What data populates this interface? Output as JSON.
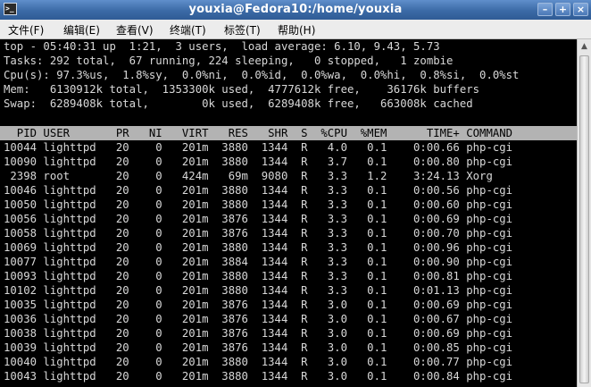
{
  "window": {
    "title": "youxia@Fedora10:/home/youxia",
    "icon_name": "terminal-icon",
    "minimize": "–",
    "maximize": "+",
    "close": "×"
  },
  "menu": [
    "文件(F)",
    "编辑(E)",
    "查看(V)",
    "终端(T)",
    "标签(T)",
    "帮助(H)"
  ],
  "summary": [
    "top - 05:40:31 up  1:21,  3 users,  load average: 6.10, 9.43, 5.73",
    "Tasks: 292 total,  67 running, 224 sleeping,   0 stopped,   1 zombie",
    "Cpu(s): 97.3%us,  1.8%sy,  0.0%ni,  0.0%id,  0.0%wa,  0.0%hi,  0.8%si,  0.0%st",
    "Mem:   6130912k total,  1353300k used,  4777612k free,    36176k buffers",
    "Swap:  6289408k total,        0k used,  6289408k free,   663008k cached"
  ],
  "columns": [
    "PID",
    "USER",
    "PR",
    "NI",
    "VIRT",
    "RES",
    "SHR",
    "S",
    "%CPU",
    "%MEM",
    "TIME+",
    "COMMAND"
  ],
  "processes": [
    [
      "10044",
      "lighttpd",
      "20",
      "0",
      "201m",
      "3880",
      "1344",
      "R",
      "4.0",
      "0.1",
      "0:00.66",
      "php-cgi"
    ],
    [
      "10090",
      "lighttpd",
      "20",
      "0",
      "201m",
      "3880",
      "1344",
      "R",
      "3.7",
      "0.1",
      "0:00.80",
      "php-cgi"
    ],
    [
      "2398",
      "root",
      "20",
      "0",
      "424m",
      "69m",
      "9080",
      "R",
      "3.3",
      "1.2",
      "3:24.13",
      "Xorg"
    ],
    [
      "10046",
      "lighttpd",
      "20",
      "0",
      "201m",
      "3880",
      "1344",
      "R",
      "3.3",
      "0.1",
      "0:00.56",
      "php-cgi"
    ],
    [
      "10050",
      "lighttpd",
      "20",
      "0",
      "201m",
      "3880",
      "1344",
      "R",
      "3.3",
      "0.1",
      "0:00.60",
      "php-cgi"
    ],
    [
      "10056",
      "lighttpd",
      "20",
      "0",
      "201m",
      "3876",
      "1344",
      "R",
      "3.3",
      "0.1",
      "0:00.69",
      "php-cgi"
    ],
    [
      "10058",
      "lighttpd",
      "20",
      "0",
      "201m",
      "3876",
      "1344",
      "R",
      "3.3",
      "0.1",
      "0:00.70",
      "php-cgi"
    ],
    [
      "10069",
      "lighttpd",
      "20",
      "0",
      "201m",
      "3880",
      "1344",
      "R",
      "3.3",
      "0.1",
      "0:00.96",
      "php-cgi"
    ],
    [
      "10077",
      "lighttpd",
      "20",
      "0",
      "201m",
      "3884",
      "1344",
      "R",
      "3.3",
      "0.1",
      "0:00.90",
      "php-cgi"
    ],
    [
      "10093",
      "lighttpd",
      "20",
      "0",
      "201m",
      "3880",
      "1344",
      "R",
      "3.3",
      "0.1",
      "0:00.81",
      "php-cgi"
    ],
    [
      "10102",
      "lighttpd",
      "20",
      "0",
      "201m",
      "3880",
      "1344",
      "R",
      "3.3",
      "0.1",
      "0:01.13",
      "php-cgi"
    ],
    [
      "10035",
      "lighttpd",
      "20",
      "0",
      "201m",
      "3876",
      "1344",
      "R",
      "3.0",
      "0.1",
      "0:00.69",
      "php-cgi"
    ],
    [
      "10036",
      "lighttpd",
      "20",
      "0",
      "201m",
      "3876",
      "1344",
      "R",
      "3.0",
      "0.1",
      "0:00.67",
      "php-cgi"
    ],
    [
      "10038",
      "lighttpd",
      "20",
      "0",
      "201m",
      "3876",
      "1344",
      "R",
      "3.0",
      "0.1",
      "0:00.69",
      "php-cgi"
    ],
    [
      "10039",
      "lighttpd",
      "20",
      "0",
      "201m",
      "3876",
      "1344",
      "R",
      "3.0",
      "0.1",
      "0:00.85",
      "php-cgi"
    ],
    [
      "10040",
      "lighttpd",
      "20",
      "0",
      "201m",
      "3880",
      "1344",
      "R",
      "3.0",
      "0.1",
      "0:00.77",
      "php-cgi"
    ],
    [
      "10043",
      "lighttpd",
      "20",
      "0",
      "201m",
      "3880",
      "1344",
      "R",
      "3.0",
      "0.1",
      "0:00.84",
      "php-cgi"
    ]
  ],
  "colors": {
    "terminal_bg": "#000000",
    "terminal_fg": "#d8d8d8",
    "header_bg": "#b3b3b3"
  }
}
